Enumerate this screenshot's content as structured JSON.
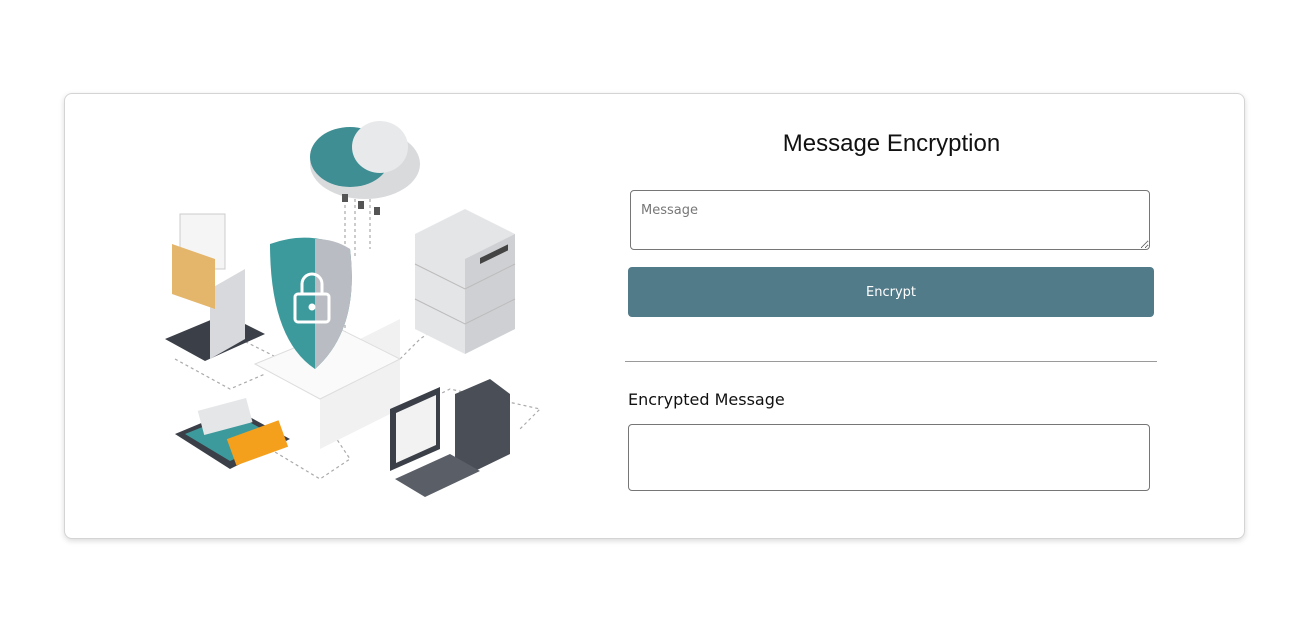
{
  "form": {
    "title": "Message Encryption",
    "message_placeholder": "Message",
    "message_value": "",
    "encrypt_label": "Encrypt",
    "output_label": "Encrypted Message",
    "output_value": ""
  },
  "colors": {
    "accent": "#527b89",
    "illustration_teal": "#3d9a9c"
  },
  "illustration": {
    "icons": [
      "cloud-icon",
      "shield-lock-icon",
      "server-icon",
      "laptop-folder-icon",
      "phone-message-icon",
      "desktop-computer-icon"
    ]
  }
}
